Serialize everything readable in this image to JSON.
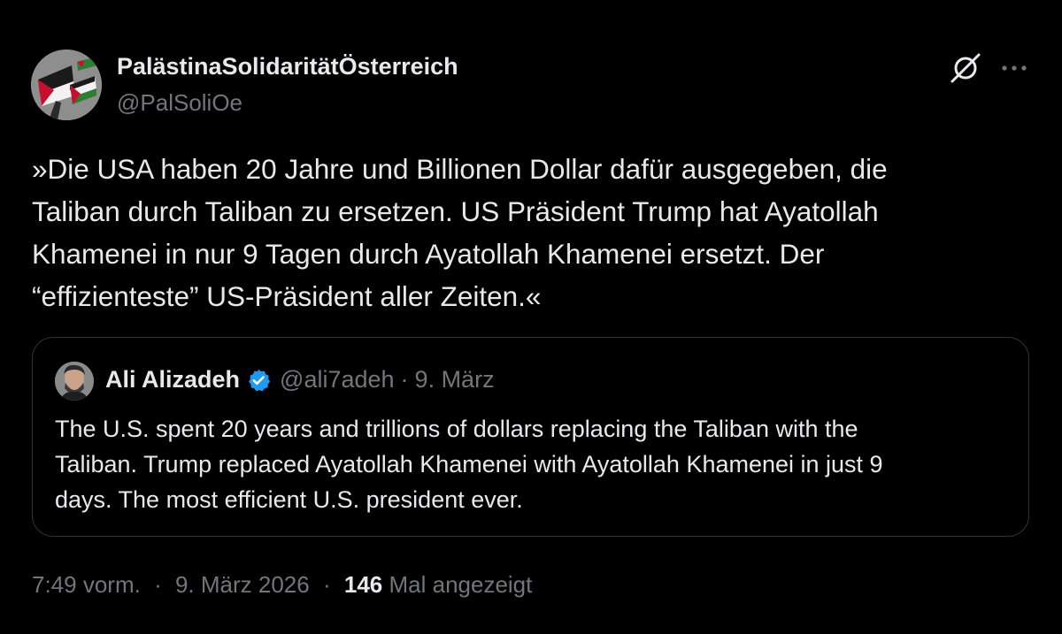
{
  "author": {
    "name": "PalästinaSolidaritätÖsterreich",
    "handle": "@PalSoliOe"
  },
  "icons": {
    "grok": "grok-slash-icon",
    "more": "more-dots-icon",
    "verified": "verified-badge-icon"
  },
  "tweet": {
    "lines": [
      "»Die USA haben 20 Jahre und Billionen Dollar dafür ausgegeben, die",
      "Taliban durch Taliban zu ersetzen. US Präsident Trump hat Ayatollah",
      "Khamenei in nur 9 Tagen durch Ayatollah Khamenei ersetzt. Der",
      "“effizienteste” US-Präsident aller Zeiten.«"
    ]
  },
  "quote": {
    "name": "Ali Alizadeh",
    "handle": "@ali7adeh",
    "separator": "·",
    "date": "9. März",
    "lines": [
      "The U.S. spent 20 years and trillions of dollars replacing the Taliban with the",
      "Taliban. Trump replaced Ayatollah Khamenei with Ayatollah Khamenei in just 9",
      "days. The most efficient U.S. president ever."
    ]
  },
  "meta": {
    "time": "7:49 vorm.",
    "separator": "·",
    "date": "9. März 2026",
    "views_count": "146",
    "views_label": "Mal angezeigt"
  },
  "colors": {
    "background": "#000000",
    "text": "#e7e9ea",
    "secondary": "#71767b",
    "border": "#2f3336",
    "verified": "#1d9bf0"
  }
}
